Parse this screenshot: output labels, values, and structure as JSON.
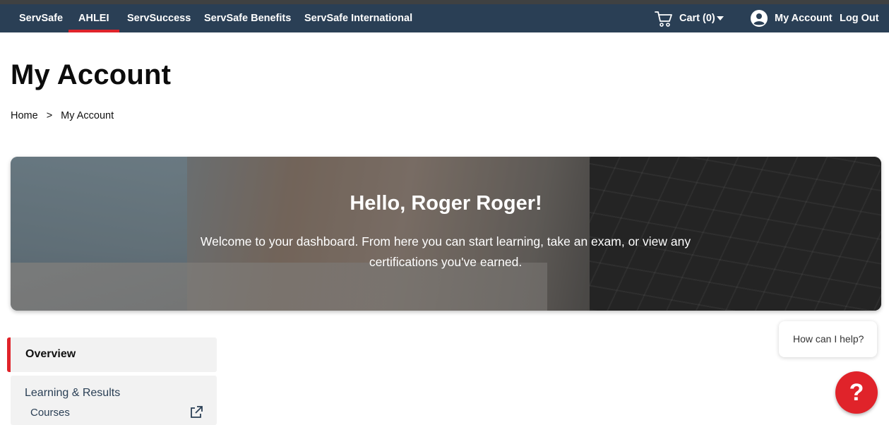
{
  "nav": {
    "items": [
      {
        "label": "ServSafe"
      },
      {
        "label": "AHLEI"
      },
      {
        "label": "ServSuccess"
      },
      {
        "label": "ServSafe Benefits"
      },
      {
        "label": "ServSafe International"
      }
    ],
    "active": "AHLEI",
    "cart_label": "Cart (0)",
    "account_label": "My Account",
    "logout_label": "Log Out"
  },
  "page": {
    "title": "My Account",
    "breadcrumb": {
      "home": "Home",
      "separator": ">",
      "current": "My Account"
    }
  },
  "hero": {
    "greeting": "Hello, Roger Roger!",
    "welcome": "Welcome to your dashboard. From here you can start learning, take an exam, or view any certifications you've earned."
  },
  "sidebar": {
    "overview_label": "Overview",
    "learning_label": "Learning & Results",
    "courses_label": "Courses"
  },
  "help": {
    "bubble_text": "How can I help?",
    "button_glyph": "?"
  },
  "colors": {
    "nav_bg": "#2a3f55",
    "accent_red": "#e0232a",
    "sidebar_bg": "#f2f2f2"
  },
  "icons": [
    "cart-icon",
    "chevron-down-icon",
    "account-icon",
    "external-link-icon",
    "question-icon"
  ]
}
